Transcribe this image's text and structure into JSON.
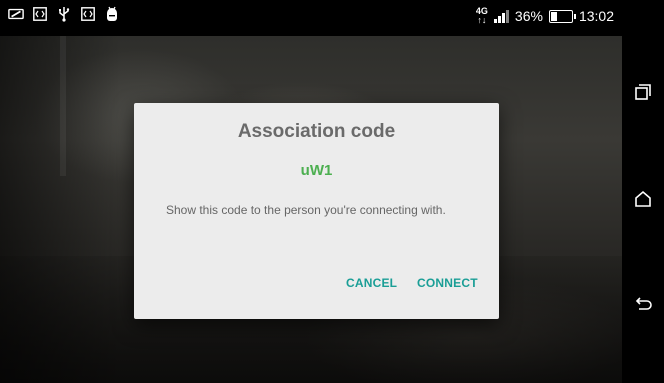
{
  "status_bar": {
    "network_type": "4G",
    "battery_percent": "36%",
    "battery_level": 0.36,
    "time": "13:02",
    "icons": [
      "notification-screenshot-icon",
      "code-icon",
      "usb-icon",
      "code-icon",
      "android-debug-icon"
    ]
  },
  "dialog": {
    "title": "Association code",
    "code": "uW1",
    "message": "Show this code to the person you're connecting with.",
    "cancel_label": "CANCEL",
    "connect_label": "CONNECT"
  },
  "navigation": {
    "buttons": [
      "recent-apps-icon",
      "home-icon",
      "back-icon"
    ]
  },
  "colors": {
    "code_green": "#4caf50",
    "button_teal": "#1a9e96",
    "dialog_bg": "#ececec"
  }
}
